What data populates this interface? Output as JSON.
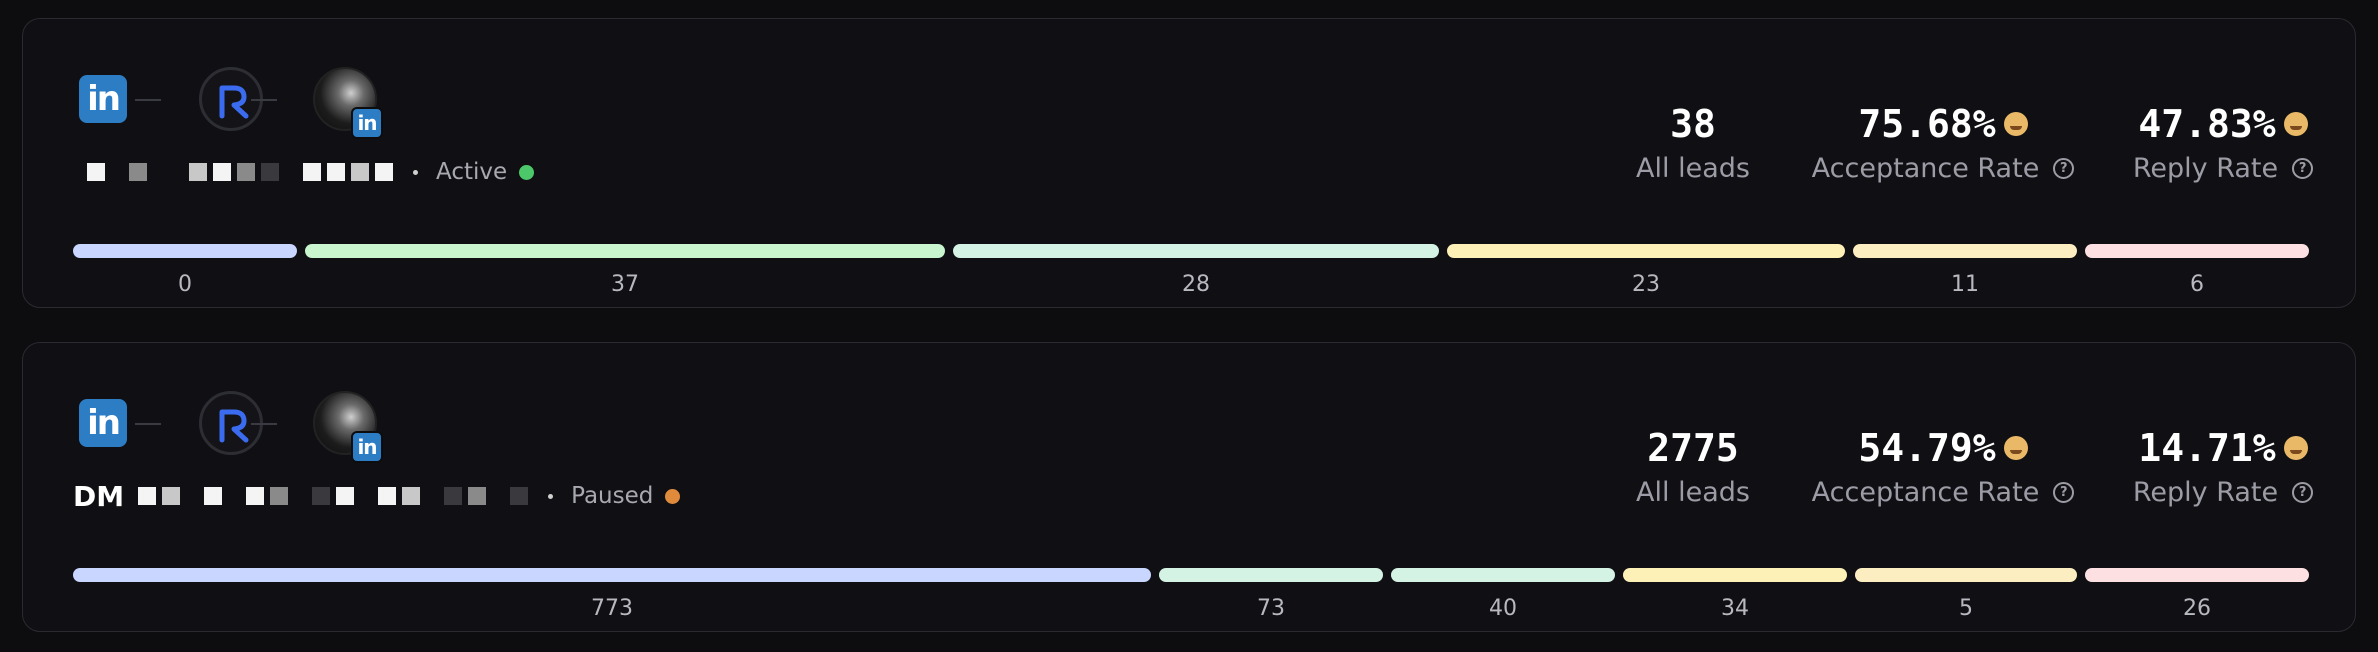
{
  "campaigns": [
    {
      "name_prefix": "",
      "status": "Active",
      "status_color": "#4cc86a",
      "leads": "38",
      "leads_label": "All leads",
      "acceptance": "75.68%",
      "acceptance_label": "Acceptance Rate",
      "reply": "47.83%",
      "reply_label": "Reply Rate",
      "acceptance_emoji": "star-struck-emoji",
      "reply_emoji": "star-struck-emoji",
      "segments": [
        "0",
        "37",
        "28",
        "23",
        "11",
        "6"
      ]
    },
    {
      "name_prefix": "DM",
      "status": "Paused",
      "status_color": "#e08a3c",
      "leads": "2775",
      "leads_label": "All leads",
      "acceptance": "54.79%",
      "acceptance_label": "Acceptance Rate",
      "reply": "14.71%",
      "reply_label": "Reply Rate",
      "acceptance_emoji": "star-struck-emoji",
      "reply_emoji": "slightly-smiling-emoji",
      "segments": [
        "773",
        "73",
        "40",
        "34",
        "5",
        "26"
      ]
    }
  ],
  "icon_labels": {
    "linkedin": "in"
  },
  "segment_colors": [
    "#c9d6ff",
    "#c9f5cf",
    "#d4f3e4",
    "#fdf1b8",
    "#fdeec2",
    "#fde1e2"
  ]
}
